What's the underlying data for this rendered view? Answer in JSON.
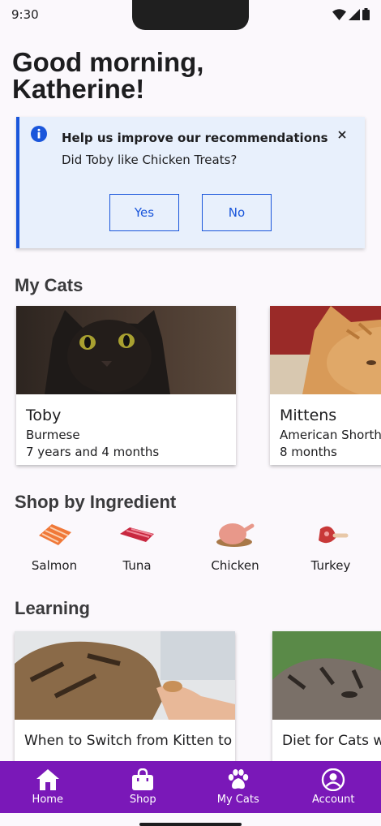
{
  "status_bar": {
    "time": "9:30"
  },
  "greeting": "Good morning, Katherine!",
  "banner": {
    "title": "Help us improve our recommendations",
    "question": "Did Toby like Chicken Treats?",
    "yes_label": "Yes",
    "no_label": "No"
  },
  "my_cats": {
    "title": "My Cats",
    "cats": [
      {
        "name": "Toby",
        "breed": "Burmese",
        "age": "7 years and 4 months"
      },
      {
        "name": "Mittens",
        "breed": "American Shorthair",
        "age": "8 months"
      }
    ]
  },
  "shop": {
    "title": "Shop by Ingredient",
    "ingredients": [
      {
        "label": "Salmon",
        "icon": "salmon-icon"
      },
      {
        "label": "Tuna",
        "icon": "tuna-icon"
      },
      {
        "label": "Chicken",
        "icon": "chicken-icon"
      },
      {
        "label": "Turkey",
        "icon": "turkey-icon"
      }
    ]
  },
  "learning": {
    "title": "Learning",
    "articles": [
      {
        "title": "When to Switch from Kitten to Adult Food"
      },
      {
        "title": "Diet for Cats with Stones"
      }
    ]
  },
  "nav": {
    "items": [
      {
        "label": "Home",
        "icon": "home-icon"
      },
      {
        "label": "Shop",
        "icon": "shopping-bag-icon"
      },
      {
        "label": "My Cats",
        "icon": "paw-icon"
      },
      {
        "label": "Account",
        "icon": "account-icon"
      }
    ]
  },
  "colors": {
    "accent": "#7a18b8",
    "link": "#1a56db",
    "banner_bg": "#e8f0fc"
  }
}
